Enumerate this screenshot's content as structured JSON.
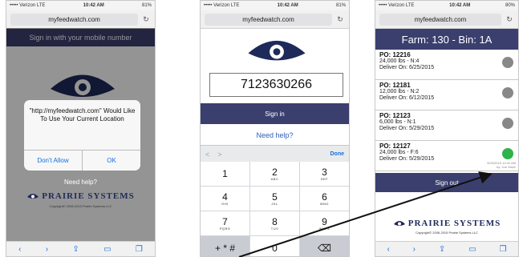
{
  "common": {
    "url": "myfeedwatch.com",
    "reload_icon": "↻"
  },
  "phone1": {
    "status": {
      "carrier": "••••• Verizon  LTE",
      "time": "10:42 AM",
      "battery": "81%"
    },
    "header": "Sign in with your mobile number",
    "dialog": {
      "message": "\"http://myfeedwatch.com\" Would Like To Use Your Current Location",
      "deny": "Don't Allow",
      "ok": "OK"
    },
    "help": "Need help?",
    "logo": "PRAIRIE SYSTEMS",
    "copyright": "Copyright© 2006-2015 Prairie Systems LLC"
  },
  "phone2": {
    "status": {
      "carrier": "••••• Verizon  LTE",
      "time": "10:42 AM",
      "battery": "81%"
    },
    "phone_number": "7123630266",
    "sign_in": "Sign in",
    "help": "Need help?",
    "toolbar": {
      "prev": "<",
      "next": ">",
      "done": "Done"
    },
    "keys": [
      {
        "d": "1",
        "l": ""
      },
      {
        "d": "2",
        "l": "ABC"
      },
      {
        "d": "3",
        "l": "DEF"
      },
      {
        "d": "4",
        "l": "GHI"
      },
      {
        "d": "5",
        "l": "JKL"
      },
      {
        "d": "6",
        "l": "MNO"
      },
      {
        "d": "7",
        "l": "PQRS"
      },
      {
        "d": "8",
        "l": "TUV"
      },
      {
        "d": "9",
        "l": "WXYZ"
      },
      {
        "d": "+ * #",
        "l": ""
      },
      {
        "d": "0",
        "l": ""
      },
      {
        "d": "⌫",
        "l": ""
      }
    ]
  },
  "phone3": {
    "status": {
      "carrier": "••••• Verizon  LTE",
      "time": "10:42 AM",
      "battery": "80%"
    },
    "header": "Farm: 130 - Bin: 1A",
    "orders": [
      {
        "po": "PO: 12216",
        "line1": "24,000 lbs - N:4",
        "line2": "Deliver On: 6/25/2015",
        "status": "pending"
      },
      {
        "po": "PO: 12181",
        "line1": "12,000 lbs - N:2",
        "line2": "Deliver On: 6/12/2015",
        "status": "pending"
      },
      {
        "po": "PO: 12123",
        "line1": "6,000 lbs - N:1",
        "line2": "Deliver On: 5/29/2015",
        "status": "pending"
      },
      {
        "po": "PO: 12127",
        "line1": "24,000 lbs - F:6",
        "line2": "Deliver On: 5/29/2015",
        "status": "confirmed",
        "stamp1": "5/29/2015 10:42 AM",
        "stamp2": "by: Joe Slave"
      }
    ],
    "sign_out": "Sign out",
    "logo": "PRAIRIE SYSTEMS",
    "copyright": "Copyright© 2006-2015 Prairie Systems LLC"
  },
  "colors": {
    "header_navy": "#3b3f6e",
    "ios_blue": "#1670d8",
    "confirmed_green": "#2fb34a",
    "pending_gray": "#888888"
  }
}
